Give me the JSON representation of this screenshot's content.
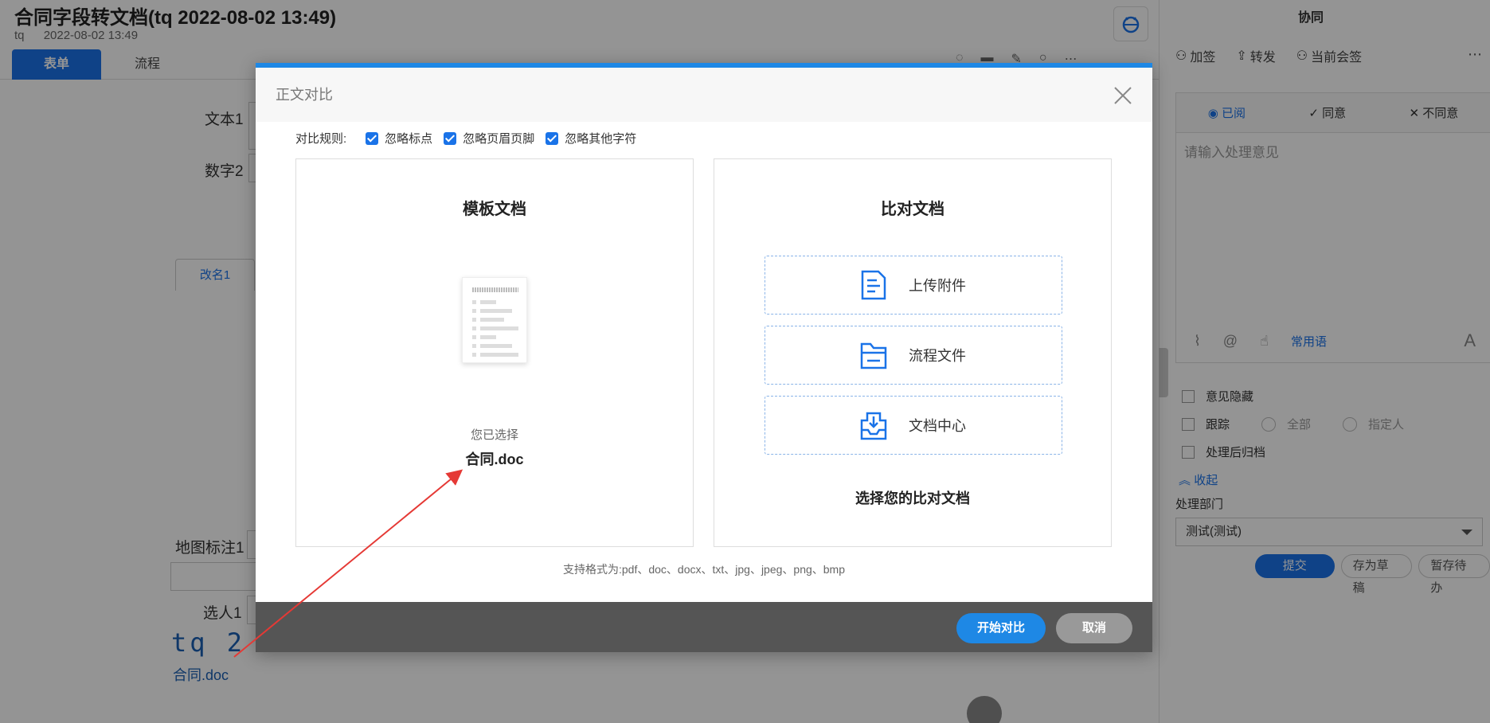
{
  "page": {
    "title": "合同字段转文档(tq 2022-08-02 13:49)",
    "author": "tq",
    "datetime": "2022-08-02 13:49",
    "tabs": {
      "form": "表单",
      "flow": "流程"
    }
  },
  "form": {
    "text1_label": "文本1",
    "number2_label": "数字2",
    "subtab_label": "改名1",
    "map_label": "地图标注1",
    "person_label": "选人1",
    "signature": "tq  2",
    "file_link": "合同.doc"
  },
  "sidebar": {
    "title": "协同",
    "actions": {
      "add_sign": "加签",
      "forward": "转发",
      "current_sign": "当前会签"
    },
    "opinion_tabs": {
      "read": "已阅",
      "agree": "同意",
      "disagree": "不同意"
    },
    "opinion_placeholder": "请输入处理意见",
    "common_phrases": "常用语",
    "font_icon": "A",
    "hide_opinion": "意见隐藏",
    "track": "跟踪",
    "track_all": "全部",
    "track_person": "指定人",
    "archive": "处理后归档",
    "collapse": "收起",
    "dept_label": "处理部门",
    "dept_value": "测试(测试)",
    "submit": "提交",
    "save_draft": "存为草稿",
    "hold": "暂存待办"
  },
  "modal": {
    "title": "正文对比",
    "rules_label": "对比规则:",
    "rules": [
      "忽略标点",
      "忽略页眉页脚",
      "忽略其他字符"
    ],
    "template": {
      "title": "模板文档",
      "selected_label": "您已选择",
      "selected_file": "合同.doc"
    },
    "compare": {
      "title": "比对文档",
      "options": [
        "上传附件",
        "流程文件",
        "文档中心"
      ],
      "hint": "选择您的比对文档"
    },
    "formats": "支持格式为:pdf、doc、docx、txt、jpg、jpeg、png、bmp",
    "start_button": "开始对比",
    "cancel_button": "取消"
  },
  "colors": {
    "accent": "#1e88e5",
    "primary": "#1a73e8",
    "overlay": "rgba(0,0,0,0.42)",
    "annotation_arrow": "#e53935"
  }
}
